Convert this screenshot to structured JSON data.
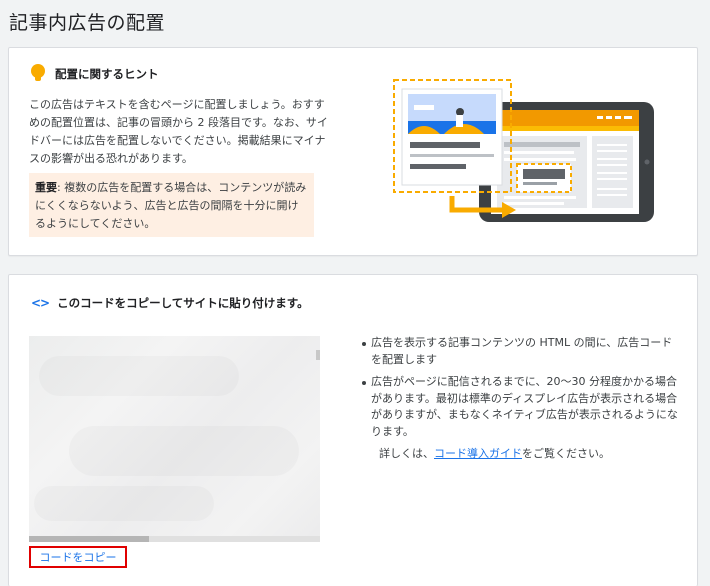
{
  "page": {
    "title": "記事内広告の配置"
  },
  "hint": {
    "title": "配置に関するヒント",
    "body": "この広告はテキストを含むページに配置しましょう。おすすめの配置位置は、記事の冒頭から 2 段落目です。なお、サイドバーには広告を配置しないでください。掲載結果にマイナスの影響が出る恐れがあります。",
    "warning_label": "重要",
    "warning_text": ": 複数の広告を配置する場合は、コンテンツが読みにくくならないよう、広告と広告の間隔を十分に開けるようにしてください。"
  },
  "code": {
    "icon": "<>",
    "title": "このコードをコピーしてサイトに貼り付けます。",
    "copy_button": "コードをコピー",
    "bullets": [
      "広告を表示する記事コンテンツの HTML の間に、広告コードを配置します",
      "広告がページに配信されるまでに、20〜30 分程度かかる場合があります。最初は標準のディスプレイ広告が表示される場合がありますが、まもなくネイティブ広告が表示されるようになります。"
    ],
    "details_prefix": "詳しくは、",
    "details_link": "コード導入ガイド",
    "details_suffix": "をご覧ください。"
  },
  "colors": {
    "accent_orange": "#f9ab00",
    "link_blue": "#1a73e8",
    "highlight_red": "#e00000",
    "warning_bg": "#feefe3"
  },
  "icons": {
    "hint": "lightbulb-icon",
    "code": "code-brackets-icon"
  }
}
